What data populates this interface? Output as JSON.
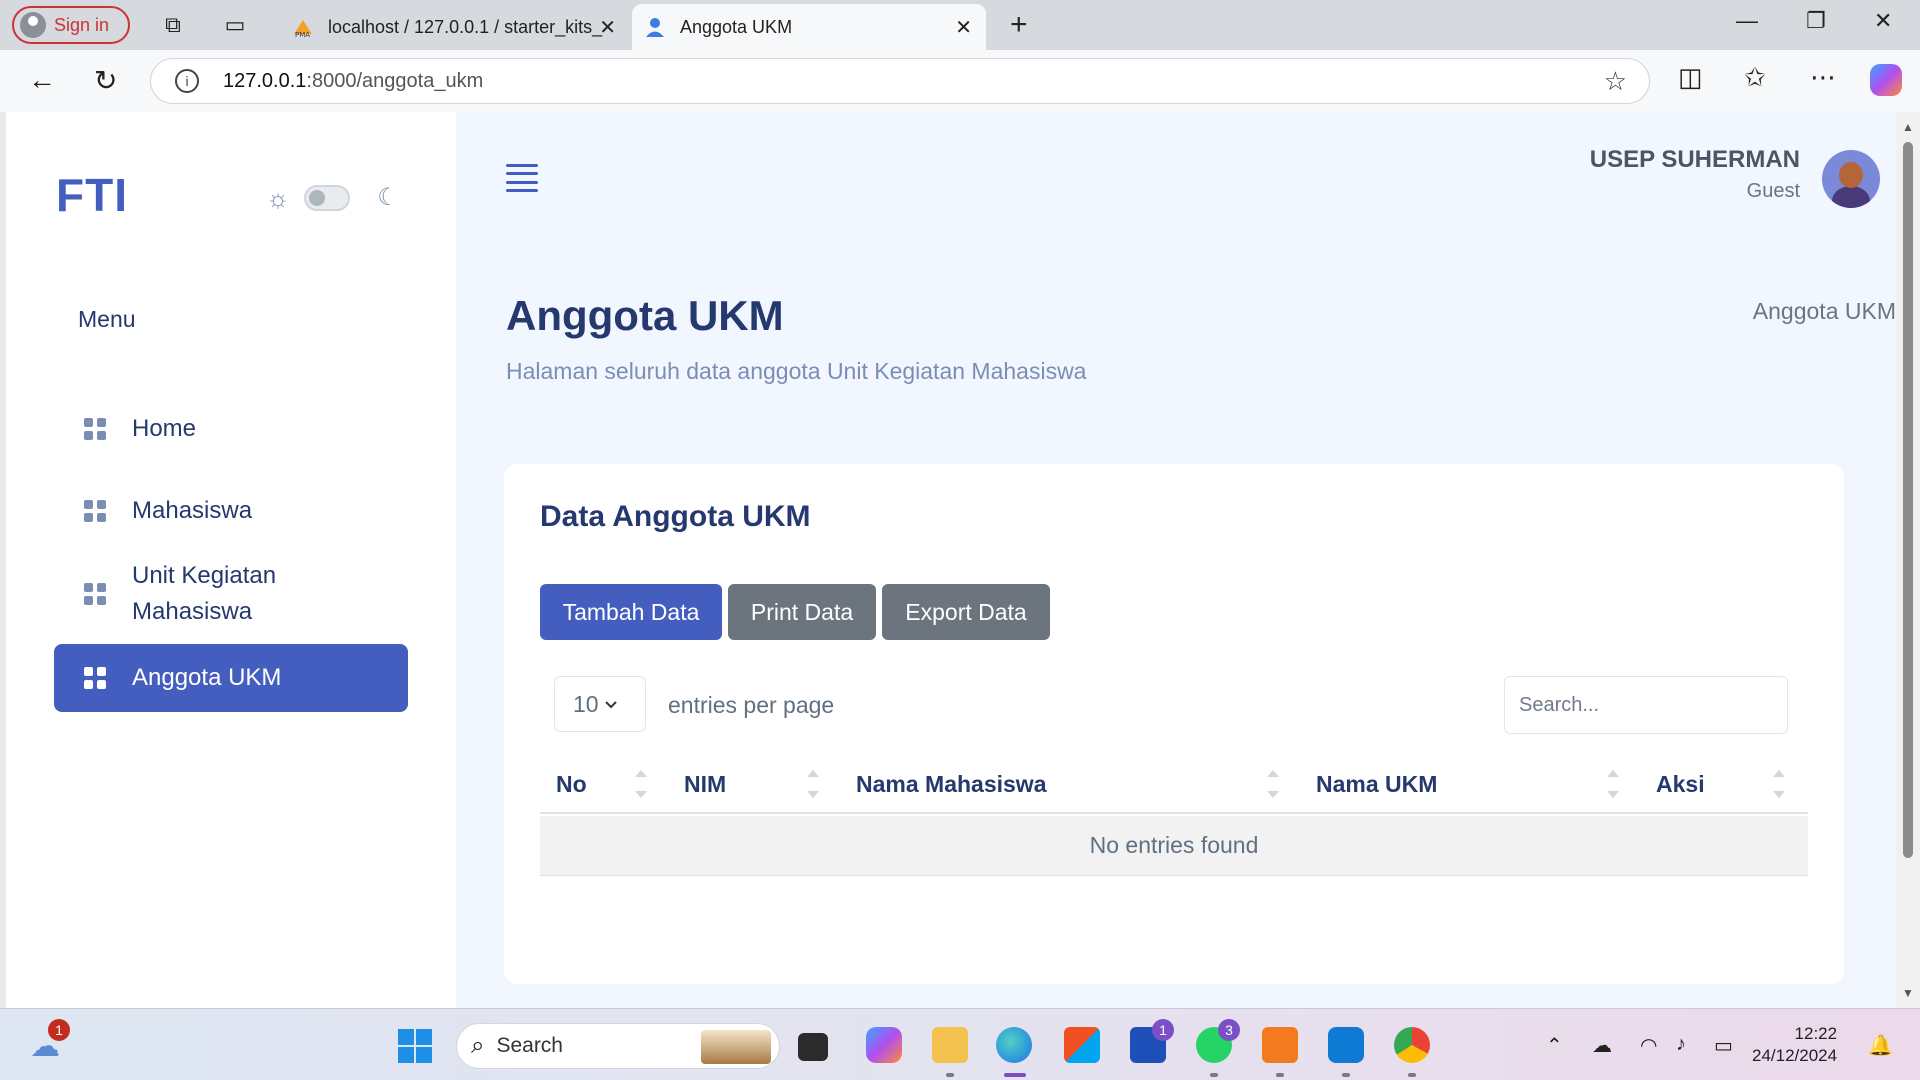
{
  "browser": {
    "signin_label": "Sign in",
    "tabs": [
      {
        "title": "localhost / 127.0.0.1 / starter_kits_",
        "icon": "phpmyadmin-icon"
      },
      {
        "title": "Anggota UKM",
        "icon": "person-icon"
      }
    ],
    "url_host": "127.0.0.1",
    "url_rest": ":8000/anggota_ukm"
  },
  "sidebar": {
    "logo": "FTI",
    "menu_title": "Menu",
    "items": [
      {
        "label": "Home"
      },
      {
        "label": "Mahasiswa"
      },
      {
        "label": "Unit Kegiatan Mahasiswa"
      },
      {
        "label": "Anggota UKM",
        "active": true
      }
    ]
  },
  "user": {
    "name": "USEP SUHERMAN",
    "role": "Guest"
  },
  "page": {
    "title": "Anggota UKM",
    "subtitle": "Halaman seluruh data anggota Unit Kegiatan Mahasiswa",
    "breadcrumb": "Anggota UKM"
  },
  "card": {
    "title": "Data Anggota UKM",
    "buttons": {
      "add": "Tambah Data",
      "print": "Print Data",
      "export": "Export Data"
    },
    "per_page_value": "10",
    "per_page_label": "entries per page",
    "search_placeholder": "Search...",
    "columns": [
      "No",
      "NIM",
      "Nama Mahasiswa",
      "Nama UKM",
      "Aksi"
    ],
    "empty_message": "No entries found"
  },
  "taskbar": {
    "search_label": "Search",
    "time": "12:22",
    "date": "24/12/2024",
    "badges": {
      "weather": "1",
      "teams": "1",
      "whatsapp": "3"
    }
  },
  "colors": {
    "primary": "#435ebe",
    "secondary": "#6c757d",
    "heading": "#25396f",
    "page_bg": "#f2f7ff"
  }
}
